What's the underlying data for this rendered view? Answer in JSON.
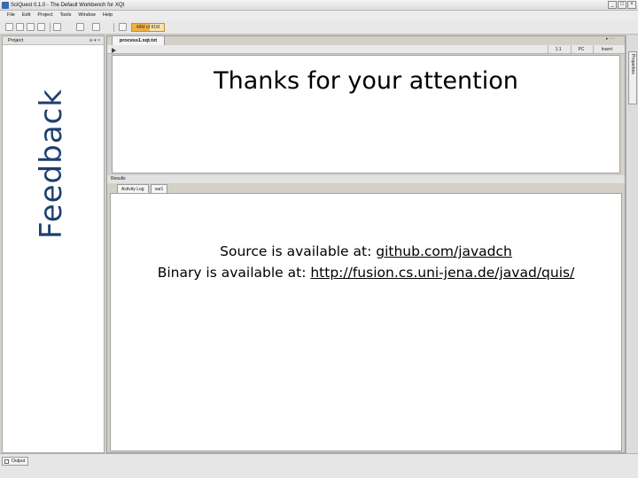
{
  "window": {
    "title": "SciQuest 0.1.0 - The Default Workbench for XQt",
    "controls": [
      "_",
      "□",
      "×"
    ]
  },
  "menu": [
    "File",
    "Edit",
    "Project",
    "Tools",
    "Window",
    "Help"
  ],
  "toolbar": {
    "memory_label": "48M of 81M"
  },
  "project_panel": {
    "title": "Project",
    "controls": "⊖ ▾ ×"
  },
  "editor": {
    "tab_label": "process1.xqt.txt",
    "status_cells": [
      "1:1",
      "PC",
      "Insert"
    ]
  },
  "results": {
    "header": "Results",
    "tabs": [
      "Activity Log",
      "var1"
    ]
  },
  "right_panel": {
    "tab_label": "Properties",
    "controls": "▸ ▫ ▫"
  },
  "bottom": {
    "output_label": "Output"
  },
  "slide": {
    "side_title": "Feedback",
    "thanks": "Thanks for your attention",
    "source_prefix": "Source is available at: ",
    "source_link": "github.com/javadch",
    "binary_prefix": "Binary is available at: ",
    "binary_link": "http://fusion.cs.uni-jena.de/javad/quis/"
  },
  "colors": {
    "feedback_text": "#1e3f6e",
    "memory_bar": "#f0b040"
  }
}
